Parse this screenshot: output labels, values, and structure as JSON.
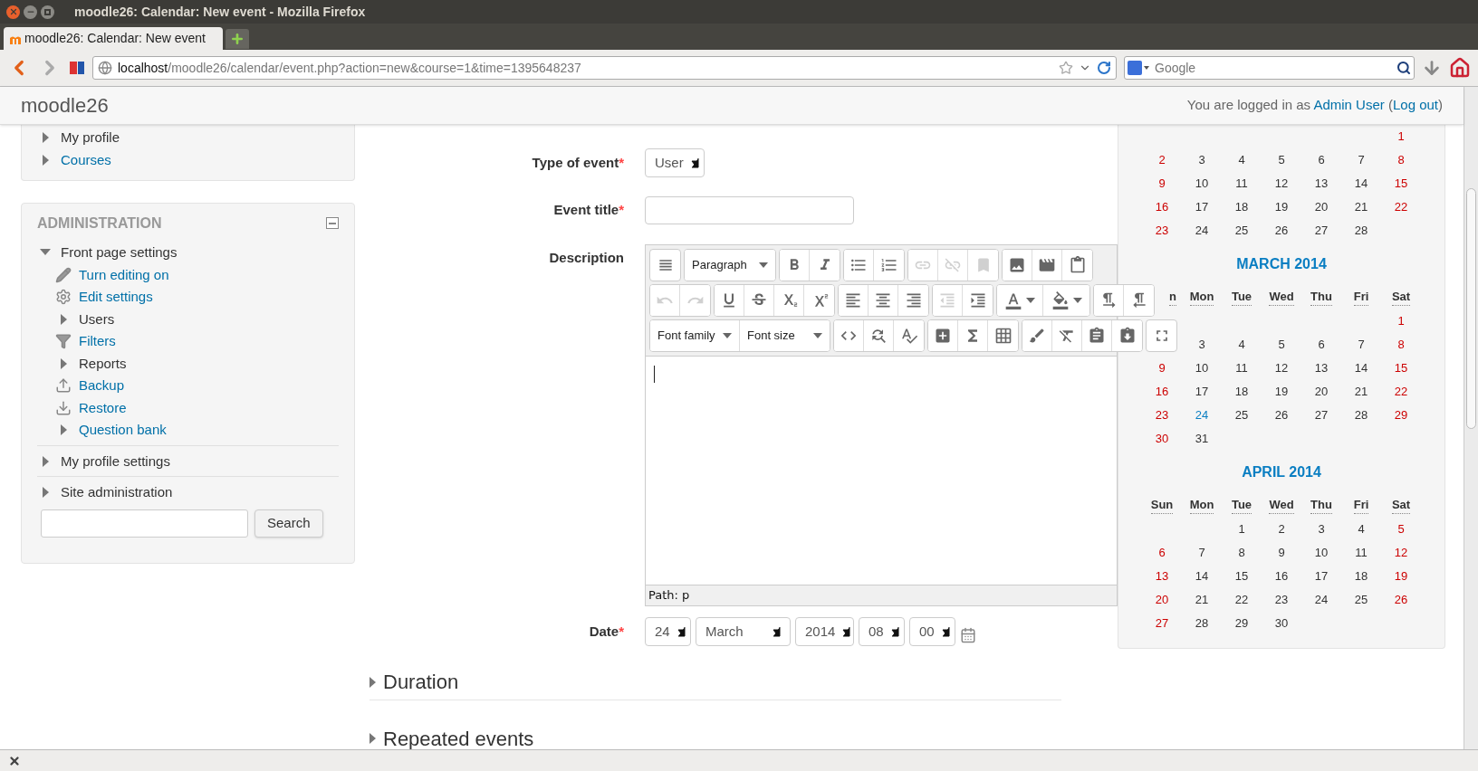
{
  "browser": {
    "window_title": "moodle26: Calendar: New event - Mozilla Firefox",
    "tabs": [
      {
        "title": "moodle26: Calendar: New event",
        "selected": true
      }
    ],
    "address": {
      "host": "localhost",
      "path": "/moodle26/calendar/event.php?action=new&course=1&time=1395648237"
    },
    "search": {
      "placeholder": "Google"
    }
  },
  "header": {
    "site_name": "moodle26",
    "login_prefix": "You are logged in as",
    "user": "Admin User",
    "open": "(",
    "logout": "Log out",
    "close": ")"
  },
  "navigation_block": {
    "items": [
      {
        "label": "My profile",
        "kind": "branch",
        "link": false,
        "expanded": false
      },
      {
        "label": "Courses",
        "kind": "branch",
        "link": true,
        "expanded": false
      }
    ]
  },
  "admin_block": {
    "title": "ADMINISTRATION",
    "items": [
      {
        "label": "Front page settings",
        "kind": "branch",
        "link": false,
        "expanded": true,
        "children": [
          {
            "label": "Turn editing on",
            "kind": "pencil",
            "link": true
          },
          {
            "label": "Edit settings",
            "kind": "gear",
            "link": true
          },
          {
            "label": "Users",
            "kind": "branch",
            "link": false,
            "expanded": false
          },
          {
            "label": "Filters",
            "kind": "filter",
            "link": true
          },
          {
            "label": "Reports",
            "kind": "branch",
            "link": false,
            "expanded": false
          },
          {
            "label": "Backup",
            "kind": "upload",
            "link": true
          },
          {
            "label": "Restore",
            "kind": "download",
            "link": true
          },
          {
            "label": "Question bank",
            "kind": "branch",
            "link": true,
            "expanded": false
          }
        ]
      },
      {
        "label": "My profile settings",
        "kind": "branch",
        "link": false,
        "expanded": false
      },
      {
        "label": "Site administration",
        "kind": "branch",
        "link": false,
        "expanded": false
      }
    ],
    "search_button": "Search"
  },
  "form": {
    "fields": [
      {
        "kind": "select",
        "label": "Type of event",
        "required_mark": "*",
        "value": "User"
      },
      {
        "kind": "text",
        "label": "Event title",
        "required_mark": "*"
      },
      {
        "kind": "editor",
        "label": "Description",
        "path": "Path: p",
        "toolbar_rows": [
          [
            [
              {
                "kind": "toggle",
                "disabled": false
              }
            ],
            [
              {
                "kind": "select",
                "label": "Paragraph"
              }
            ],
            [
              {
                "kind": "bold",
                "disabled": false
              },
              {
                "kind": "italic",
                "disabled": false
              }
            ],
            [
              {
                "kind": "bullets",
                "disabled": false
              },
              {
                "kind": "numbers",
                "disabled": false
              }
            ],
            [
              {
                "kind": "link",
                "disabled": true
              },
              {
                "kind": "unlink",
                "disabled": true
              },
              {
                "kind": "anchor",
                "disabled": true
              }
            ],
            [
              {
                "kind": "image",
                "disabled": false
              },
              {
                "kind": "media",
                "disabled": false
              },
              {
                "kind": "files",
                "disabled": false
              }
            ]
          ],
          [
            [
              {
                "kind": "undo",
                "disabled": true
              },
              {
                "kind": "redo",
                "disabled": true
              }
            ],
            [
              {
                "kind": "underline",
                "disabled": false
              },
              {
                "kind": "strike",
                "disabled": false
              },
              {
                "kind": "subscript",
                "disabled": false
              },
              {
                "kind": "superscript",
                "disabled": false
              }
            ],
            [
              {
                "kind": "align_left",
                "disabled": false
              },
              {
                "kind": "align_center",
                "disabled": false
              },
              {
                "kind": "align_right",
                "disabled": false
              }
            ],
            [
              {
                "kind": "outdent",
                "disabled": true
              },
              {
                "kind": "indent",
                "disabled": false
              }
            ],
            [
              {
                "kind": "text_color",
                "disabled": false
              },
              {
                "kind": "fill_color",
                "disabled": false
              }
            ],
            [
              {
                "kind": "ltr",
                "disabled": false
              },
              {
                "kind": "rtl",
                "disabled": false
              }
            ]
          ],
          [
            [
              {
                "kind": "select",
                "label": "Font family"
              },
              {
                "kind": "select",
                "label": "Font size"
              }
            ],
            [
              {
                "kind": "code",
                "disabled": false
              },
              {
                "kind": "find",
                "disabled": false
              },
              {
                "kind": "spellcheck",
                "disabled": false
              }
            ],
            [
              {
                "kind": "insert",
                "disabled": false
              },
              {
                "kind": "special",
                "disabled": false
              },
              {
                "kind": "table",
                "disabled": false
              }
            ],
            [
              {
                "kind": "cleanup",
                "disabled": false
              },
              {
                "kind": "clear_format",
                "disabled": false
              },
              {
                "kind": "paste_text",
                "disabled": false
              },
              {
                "kind": "paste_word",
                "disabled": false
              }
            ],
            [
              {
                "kind": "fullscreen",
                "disabled": false
              }
            ]
          ]
        ]
      },
      {
        "kind": "date",
        "label": "Date",
        "required_mark": "*",
        "parts": [
          "24",
          "March",
          "2014",
          "08",
          "00"
        ]
      }
    ],
    "sections": [
      {
        "title": "Duration",
        "expanded": false
      },
      {
        "title": "Repeated events",
        "expanded": false
      }
    ]
  },
  "calendar": {
    "months": [
      {
        "weeks": [
          {
            "kind": "right_aligned",
            "days": [
              "1"
            ]
          },
          {
            "kind": "left_aligned",
            "days": [
              "2",
              "3",
              "4",
              "5",
              "6",
              "7",
              "8"
            ]
          },
          {
            "kind": "left_aligned",
            "days": [
              "9",
              "10",
              "11",
              "12",
              "13",
              "14",
              "15"
            ]
          },
          {
            "kind": "left_aligned",
            "days": [
              "16",
              "17",
              "18",
              "19",
              "20",
              "21",
              "22"
            ]
          },
          {
            "kind": "left_aligned",
            "days": [
              "23",
              "24",
              "25",
              "26",
              "27",
              "28"
            ]
          }
        ]
      },
      {
        "title": "MARCH 2014",
        "weekdays": [
          "n",
          "Mon",
          "Tue",
          "Wed",
          "Thu",
          "Fri",
          "Sat"
        ],
        "weeks": [
          {
            "kind": "right_aligned",
            "days": [
              "1"
            ]
          },
          {
            "kind": "right_aligned",
            "days": [
              "3",
              "4",
              "5",
              "6",
              "7",
              "8"
            ]
          },
          {
            "kind": "left_aligned",
            "days": [
              "9",
              "10",
              "11",
              "12",
              "13",
              "14",
              "15"
            ]
          },
          {
            "kind": "left_aligned",
            "days": [
              "16",
              "17",
              "18",
              "19",
              "20",
              "21",
              "22"
            ]
          },
          {
            "kind": "left_aligned",
            "days": [
              "23",
              {
                "text": "24",
                "today": true
              },
              "25",
              "26",
              "27",
              "28",
              "29"
            ]
          },
          {
            "kind": "left_aligned",
            "days": [
              "30",
              "31"
            ]
          }
        ]
      },
      {
        "title": "APRIL 2014",
        "weekdays": [
          "Sun",
          "Mon",
          "Tue",
          "Wed",
          "Thu",
          "Fri",
          "Sat"
        ],
        "weeks": [
          {
            "kind": "right_aligned",
            "days": [
              "1",
              "2",
              "3",
              "4",
              "5"
            ]
          },
          {
            "kind": "left_aligned",
            "days": [
              "6",
              "7",
              "8",
              "9",
              "10",
              "11",
              "12"
            ]
          },
          {
            "kind": "left_aligned",
            "days": [
              "13",
              "14",
              "15",
              "16",
              "17",
              "18",
              "19"
            ]
          },
          {
            "kind": "left_aligned",
            "days": [
              "20",
              "21",
              "22",
              "23",
              "24",
              "25",
              "26"
            ]
          },
          {
            "kind": "left_aligned",
            "days": [
              "27",
              "28",
              "29",
              "30"
            ]
          }
        ]
      }
    ]
  }
}
